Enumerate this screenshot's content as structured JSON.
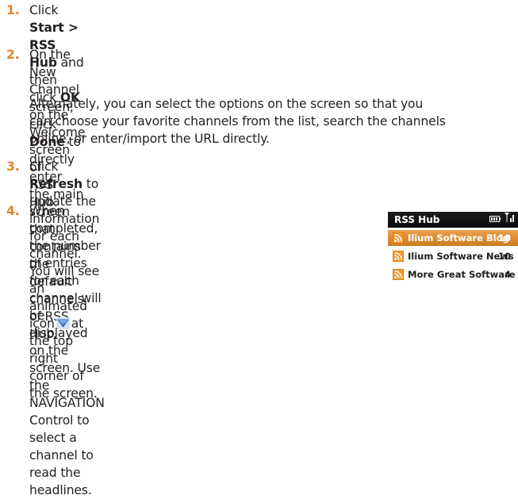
{
  "steps": [
    {
      "num": "1.",
      "line1": {
        "a": "Click ",
        "b1": "Start > RSS Hub",
        "c": " and then click ",
        "b2": "OK",
        "d": " on the Welcome screen of"
      },
      "line2": "RSS Hub."
    },
    {
      "num": "2.",
      "line1": {
        "a": "On the New Channel screen, click ",
        "b": "Done",
        "c": " to directly enter the main"
      },
      "line2": "screen that contains the default channels of RSS Hub."
    },
    {
      "num": "3.",
      "line1": {
        "a": "Click ",
        "b": "Refresh",
        "c": " to update the information for each channel. You will see"
      },
      "line2": {
        "a": "an animated icon",
        "c": "at the top right corner of the screen."
      }
    },
    {
      "num": "4.",
      "lines": [
        "When completed, the number of entries",
        "for each channel will be displayed on the",
        "screen. Use the NAVIGATION Control to",
        "select a channel to read the headlines."
      ]
    }
  ],
  "alternate": {
    "lines": [
      "Alternately, you can select the options on the screen so that you",
      "can choose your favorite channels from the list, search the channels",
      "online, or enter/import the URL directly."
    ]
  },
  "phone": {
    "title": "RSS Hub",
    "channels": [
      {
        "name": "Ilium Software Blog",
        "count": "10",
        "selected": true
      },
      {
        "name": "Ilium Software News",
        "count": "10",
        "selected": false
      },
      {
        "name": "More Great Software",
        "count": "4",
        "selected": false
      }
    ]
  },
  "colors": {
    "step_number": "#e0852c",
    "text": "#231f20",
    "selected_row": "#d98a30",
    "title_bar": "#111111",
    "rss_icon": "#f08a1c"
  },
  "icons": {
    "refresh_indicator": "animated-refresh-icon",
    "rss": "rss-feed-icon",
    "battery": "battery-icon",
    "signal": "signal-icon"
  }
}
